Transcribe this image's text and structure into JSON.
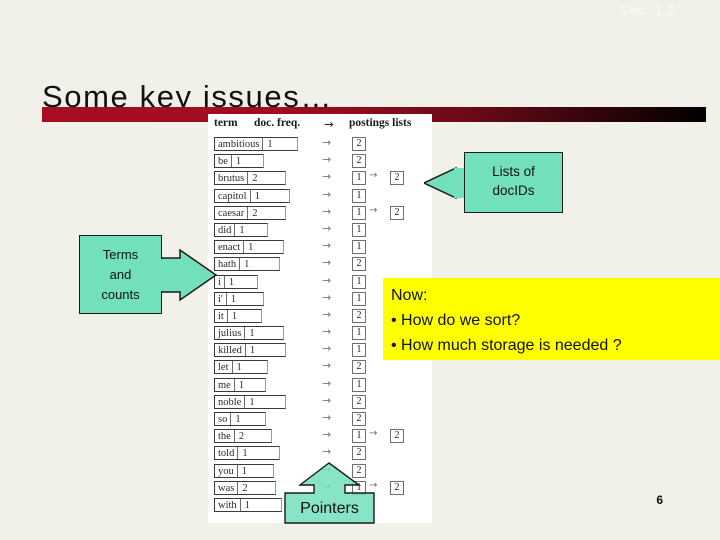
{
  "slide": {
    "section_label": "Sec. 1.2",
    "title": "Some key issues…",
    "number": "6",
    "background_color": "#f2f1e9",
    "rule_color": "#a80d23"
  },
  "figure": {
    "headers": {
      "term": "term",
      "doc_freq": "doc. freq.",
      "arrow": "→",
      "postings": "postings lists"
    },
    "rows": [
      {
        "term": "ambitious",
        "df": "1",
        "arrow": "→",
        "postings": [
          "2"
        ]
      },
      {
        "term": "be",
        "df": "1",
        "arrow": "→",
        "postings": [
          "2"
        ]
      },
      {
        "term": "brutus",
        "df": "2",
        "arrow": "→",
        "postings": [
          "1",
          "2"
        ]
      },
      {
        "term": "capitol",
        "df": "1",
        "arrow": "→",
        "postings": [
          "1"
        ]
      },
      {
        "term": "caesar",
        "df": "2",
        "arrow": "→",
        "postings": [
          "1",
          "2"
        ]
      },
      {
        "term": "did",
        "df": "1",
        "arrow": "→",
        "postings": [
          "1"
        ]
      },
      {
        "term": "enact",
        "df": "1",
        "arrow": "→",
        "postings": [
          "1"
        ]
      },
      {
        "term": "hath",
        "df": "1",
        "arrow": "→",
        "postings": [
          "2"
        ]
      },
      {
        "term": "i",
        "df": "1",
        "arrow": "→",
        "postings": [
          "1"
        ]
      },
      {
        "term": "i'",
        "df": "1",
        "arrow": "→",
        "postings": [
          "1"
        ]
      },
      {
        "term": "it",
        "df": "1",
        "arrow": "→",
        "postings": [
          "2"
        ]
      },
      {
        "term": "julius",
        "df": "1",
        "arrow": "→",
        "postings": [
          "1"
        ]
      },
      {
        "term": "killed",
        "df": "1",
        "arrow": "→",
        "postings": [
          "1"
        ]
      },
      {
        "term": "let",
        "df": "1",
        "arrow": "→",
        "postings": [
          "2"
        ]
      },
      {
        "term": "me",
        "df": "1",
        "arrow": "→",
        "postings": [
          "1"
        ]
      },
      {
        "term": "noble",
        "df": "1",
        "arrow": "→",
        "postings": [
          "2"
        ]
      },
      {
        "term": "so",
        "df": "1",
        "arrow": "→",
        "postings": [
          "2"
        ]
      },
      {
        "term": "the",
        "df": "2",
        "arrow": "→",
        "postings": [
          "1",
          "2"
        ]
      },
      {
        "term": "told",
        "df": "1",
        "arrow": "→",
        "postings": [
          "2"
        ]
      },
      {
        "term": "you",
        "df": "1",
        "arrow": "→",
        "postings": [
          "2"
        ]
      },
      {
        "term": "was",
        "df": "2",
        "arrow": "→",
        "postings": [
          "1",
          "2"
        ]
      },
      {
        "term": "with",
        "df": "1",
        "arrow": "→",
        "postings": []
      }
    ]
  },
  "callouts": {
    "lists": {
      "line1": "Lists of",
      "line2": "docIDs",
      "color": "#73e0bd"
    },
    "terms": {
      "line1": "Terms",
      "line2": "and",
      "line3": "counts",
      "color": "#73e0bd"
    },
    "pointers": {
      "label": "Pointers",
      "color": "#73e0bd"
    },
    "now": {
      "heading": "Now:",
      "bullet1": "• How do we sort?",
      "bullet2": "• How much storage is needed ?",
      "color": "#ffff00"
    }
  }
}
